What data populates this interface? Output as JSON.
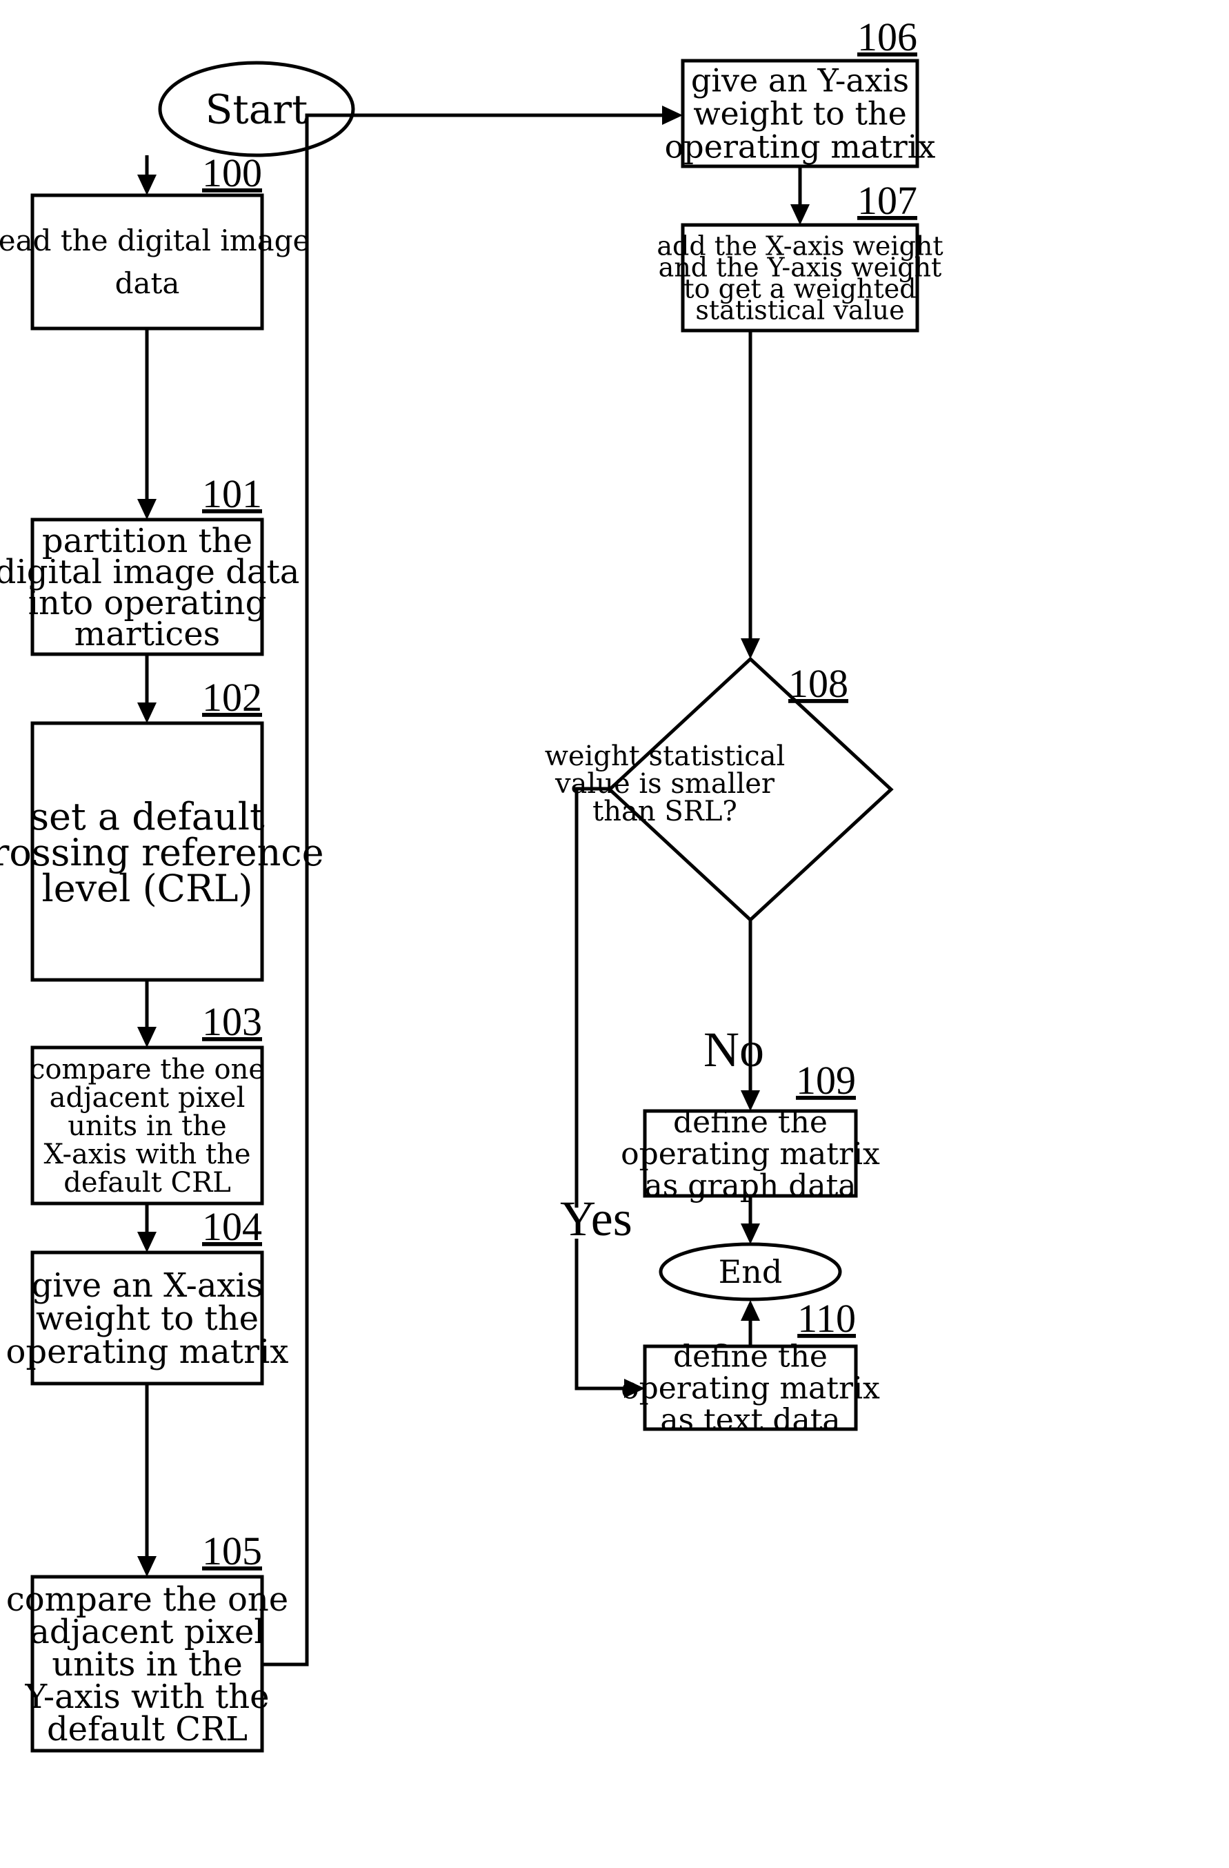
{
  "figure": {
    "nodes": [
      {
        "id": "start",
        "type": "terminal",
        "lines": [
          "Start"
        ]
      },
      {
        "id": "100",
        "ref": "100",
        "type": "process",
        "lines": [
          "read the digital image",
          "data"
        ]
      },
      {
        "id": "101",
        "ref": "101",
        "type": "process",
        "lines": [
          "partition the",
          "digital image data",
          "into operating",
          "martices"
        ]
      },
      {
        "id": "102",
        "ref": "102",
        "type": "process",
        "lines": [
          "set a default",
          "crossing reference",
          "level (CRL)"
        ]
      },
      {
        "id": "103",
        "ref": "103",
        "type": "process",
        "lines": [
          "compare the one",
          "adjacent pixel",
          "units in the",
          "X-axis with the",
          "default CRL"
        ]
      },
      {
        "id": "104",
        "ref": "104",
        "type": "process",
        "lines": [
          "give an X-axis",
          "weight to the",
          "operating matrix"
        ]
      },
      {
        "id": "105",
        "ref": "105",
        "type": "process",
        "lines": [
          "compare the one",
          "adjacent pixel",
          "units in the",
          "Y-axis with the",
          "default CRL"
        ]
      },
      {
        "id": "106",
        "ref": "106",
        "type": "process",
        "lines": [
          "give an Y-axis",
          "weight to the",
          "operating matrix"
        ]
      },
      {
        "id": "107",
        "ref": "107",
        "type": "process",
        "lines": [
          "add the X-axis weight",
          "and the Y-axis weight",
          "to get a weighted",
          "statistical value"
        ]
      },
      {
        "id": "108",
        "ref": "108",
        "type": "decision",
        "lines": [
          "weight statistical",
          "value is smaller",
          "than SRL?"
        ]
      },
      {
        "id": "109",
        "ref": "109",
        "type": "process",
        "lines": [
          "define the",
          "operating matrix",
          "as graph data"
        ]
      },
      {
        "id": "end",
        "type": "terminal",
        "lines": [
          "End"
        ]
      },
      {
        "id": "110",
        "ref": "110",
        "type": "process",
        "lines": [
          "define the",
          "operating matrix",
          "as text data"
        ]
      }
    ],
    "branch_labels": {
      "no": "No",
      "yes": "Yes"
    },
    "edges": [
      {
        "from": "start",
        "to": "100"
      },
      {
        "from": "100",
        "to": "101"
      },
      {
        "from": "101",
        "to": "102"
      },
      {
        "from": "102",
        "to": "103"
      },
      {
        "from": "103",
        "to": "104"
      },
      {
        "from": "104",
        "to": "105"
      },
      {
        "from": "105",
        "to": "106"
      },
      {
        "from": "106",
        "to": "107"
      },
      {
        "from": "107",
        "to": "108"
      },
      {
        "from": "108",
        "to": "109",
        "label": "No"
      },
      {
        "from": "108",
        "to": "110",
        "label": "Yes"
      },
      {
        "from": "109",
        "to": "end"
      },
      {
        "from": "110",
        "to": "end"
      }
    ]
  }
}
